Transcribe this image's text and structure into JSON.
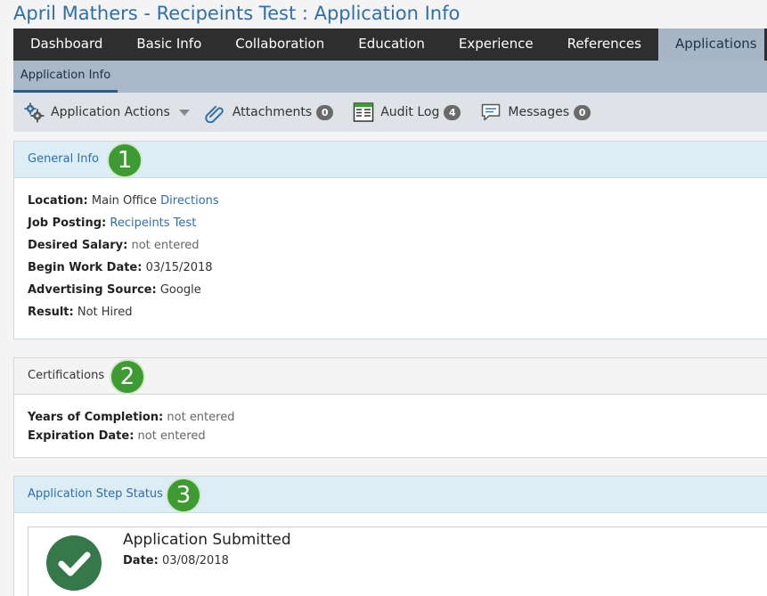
{
  "page": {
    "title": "April Mathers - Recipeints Test : Application Info"
  },
  "nav": {
    "items": [
      {
        "label": "Dashboard"
      },
      {
        "label": "Basic Info"
      },
      {
        "label": "Collaboration"
      },
      {
        "label": "Education"
      },
      {
        "label": "Experience"
      },
      {
        "label": "References"
      },
      {
        "label": "Applications",
        "active": true
      }
    ]
  },
  "subnav": {
    "label": "Application Info"
  },
  "toolbar": {
    "actions_label": "Application Actions",
    "attachments_label": "Attachments",
    "attachments_count": "0",
    "audit_label": "Audit Log",
    "audit_count": "4",
    "messages_label": "Messages",
    "messages_count": "0"
  },
  "general": {
    "title": "General Info",
    "step": "1",
    "location_label": "Location:",
    "location_value": "Main Office",
    "location_link": "Directions",
    "posting_label": "Job Posting:",
    "posting_value": "Recipeints Test",
    "salary_label": "Desired Salary:",
    "salary_value": "not entered",
    "begin_label": "Begin Work Date:",
    "begin_value": "03/15/2018",
    "source_label": "Advertising Source:",
    "source_value": "Google",
    "result_label": "Result:",
    "result_value": "Not Hired"
  },
  "certifications": {
    "title": "Certifications",
    "step": "2",
    "years_label": "Years of Completion:",
    "years_value": "not entered",
    "expiration_label": "Expiration Date:",
    "expiration_value": "not entered"
  },
  "step_status": {
    "title": "Application Step Status",
    "step": "3",
    "item_title": "Application Submitted",
    "date_label": "Date:",
    "date_value": "03/08/2018"
  },
  "colors": {
    "title_blue": "#2f6fa8",
    "nav_dark": "#2e2e2e",
    "step_green": "#3e9a33",
    "check_green": "#36784a"
  },
  "icons": {
    "actions": "gears-icon",
    "attachments": "paperclip-icon",
    "audit": "ledger-icon",
    "messages": "speech-bubble-icon",
    "status": "checkmark-icon"
  }
}
